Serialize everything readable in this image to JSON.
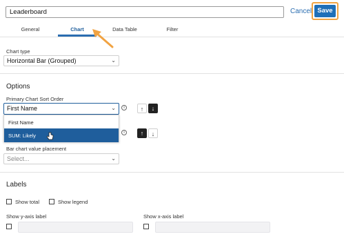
{
  "header": {
    "title_value": "Leaderboard",
    "cancel_label": "Cancel",
    "save_label": "Save"
  },
  "tabs": [
    {
      "label": "General",
      "active": false
    },
    {
      "label": "Chart",
      "active": true
    },
    {
      "label": "Data Table",
      "active": false
    },
    {
      "label": "Filter",
      "active": false
    }
  ],
  "chart_type": {
    "label": "Chart type",
    "value": "Horizontal Bar (Grouped)"
  },
  "options": {
    "title": "Options",
    "primary_sort": {
      "label": "Primary Chart Sort Order",
      "value": "First Name"
    },
    "dropdown_items": [
      {
        "label": "First Name",
        "highlighted": false
      },
      {
        "label": "SUM: Likely",
        "highlighted": true
      }
    ],
    "value_placement": {
      "label": "Bar chart value placement",
      "placeholder": "Select..."
    }
  },
  "labels": {
    "title": "Labels",
    "show_total": "Show total",
    "show_legend": "Show legend",
    "show_y_axis": "Show y-axis label",
    "show_x_axis": "Show x-axis label"
  },
  "colors": {
    "accent": "#1f6fb8",
    "highlight_orange": "#f1a342",
    "selected_row": "#1f5e9c"
  }
}
